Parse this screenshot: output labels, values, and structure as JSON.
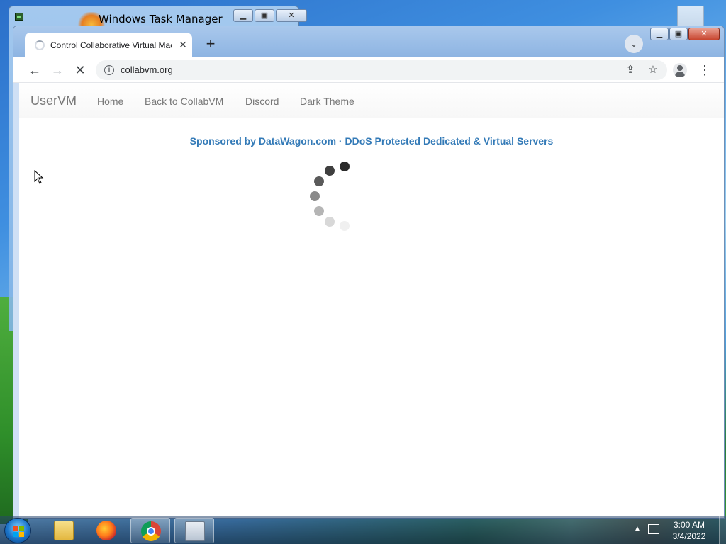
{
  "desktop": {
    "task_manager": {
      "title": "Windows Task Manager",
      "minimize": "▁",
      "maximize": "▣",
      "close": "✕"
    }
  },
  "browser": {
    "tab": {
      "title": "Control Collaborative Virtual Mac",
      "close_icon": "✕"
    },
    "new_tab_icon": "+",
    "tab_search_icon": "⌄",
    "window_controls": {
      "minimize": "▁",
      "maximize": "▣",
      "close": "✕"
    },
    "toolbar": {
      "back_icon": "←",
      "forward_icon": "→",
      "stop_icon": "✕",
      "info_icon": "i",
      "url": "collabvm.org",
      "share_icon": "⇪",
      "bookmark_icon": "☆",
      "menu_icon": "⋮"
    }
  },
  "page": {
    "brand": "UserVM",
    "nav": [
      "Home",
      "Back to CollabVM",
      "Discord",
      "Dark Theme"
    ],
    "sponsor": "Sponsored by DataWagon.com · DDoS Protected Dedicated & Virtual Servers",
    "accent_color": "#337ab7"
  },
  "taskbar": {
    "apps": [
      "file-explorer",
      "firefox",
      "chrome",
      "task-manager"
    ],
    "clock_time": "3:00 AM",
    "clock_date": "3/4/2022"
  }
}
